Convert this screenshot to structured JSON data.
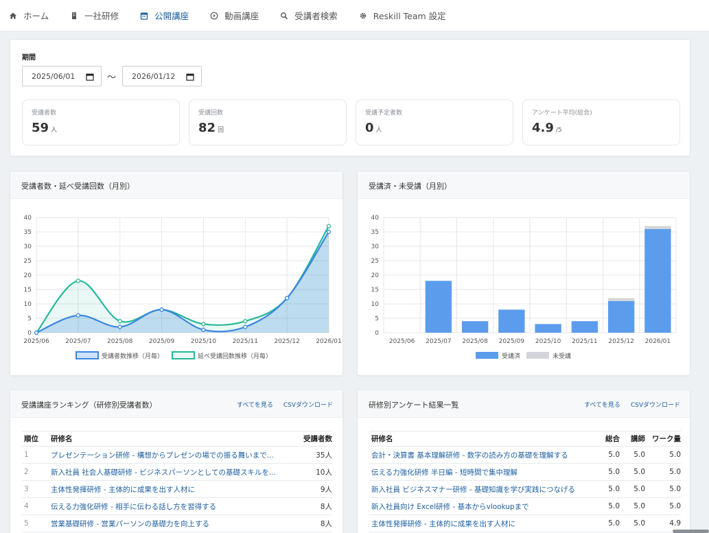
{
  "nav": {
    "items": [
      {
        "label": "ホーム"
      },
      {
        "label": "一社研修"
      },
      {
        "label": "公開講座"
      },
      {
        "label": "動画講座"
      },
      {
        "label": "受講者検索"
      },
      {
        "label": "Reskill Team 設定"
      }
    ],
    "active_index": 2
  },
  "period": {
    "label": "期間",
    "start": "2025/06/01",
    "end": "2026/01/12",
    "separator": "〜"
  },
  "stats": [
    {
      "label": "受講者数",
      "value": "59",
      "unit": "人"
    },
    {
      "label": "受講回数",
      "value": "82",
      "unit": "回"
    },
    {
      "label": "受講予定者数",
      "value": "0",
      "unit": "人"
    },
    {
      "label": "アンケート平均(総合)",
      "value": "4.9",
      "unit": "/5"
    }
  ],
  "line_card": {
    "title": "受講者数・延べ受講回数（月別）"
  },
  "bar_card": {
    "title": "受講済・未受講（月別）"
  },
  "colors": {
    "blue": "#3a86e0",
    "teal": "#26b89a",
    "bar_done": "#5b9cec",
    "bar_pending": "#d3d5d8",
    "link": "#1d5fa0"
  },
  "chart_data": [
    {
      "type": "line",
      "categories": [
        "2025/06",
        "2025/07",
        "2025/08",
        "2025/09",
        "2025/10",
        "2025/11",
        "2025/12",
        "2026/01"
      ],
      "series": [
        {
          "name": "受講者数推移（月毎）",
          "values": [
            0,
            6,
            2,
            8,
            1,
            2,
            12,
            35
          ]
        },
        {
          "name": "延べ受講回数推移（月毎）",
          "values": [
            0,
            18,
            4,
            8,
            3,
            4,
            12,
            37
          ]
        }
      ],
      "y_ticks": [
        "0",
        "5",
        "10",
        "15",
        "20",
        "25",
        "30",
        "35",
        "40"
      ],
      "ylim": [
        0,
        40
      ],
      "grid": true,
      "legend": "bottom"
    },
    {
      "type": "bar",
      "stacked": true,
      "categories": [
        "2025/06",
        "2025/07",
        "2025/08",
        "2025/09",
        "2025/10",
        "2025/11",
        "2025/12",
        "2026/01"
      ],
      "series": [
        {
          "name": "受講済",
          "values": [
            0,
            18,
            4,
            8,
            3,
            4,
            11,
            36
          ]
        },
        {
          "name": "未受講",
          "values": [
            0,
            0,
            0,
            0,
            0,
            0,
            1,
            1
          ]
        }
      ],
      "y_ticks": [
        "0",
        "5",
        "10",
        "15",
        "20",
        "25",
        "30",
        "35",
        "40"
      ],
      "ylim": [
        0,
        40
      ],
      "grid": true,
      "legend": "bottom"
    }
  ],
  "ranking": {
    "title": "受講講座ランキング（研修別受講者数）",
    "links": {
      "all": "すべてを見る",
      "csv": "CSVダウンロード"
    },
    "headers": {
      "rank": "順位",
      "name": "研修名",
      "count": "受講者数"
    },
    "rows": [
      {
        "rank": "1",
        "name": "プレゼンテーション研修 - 構想からプレゼンの場での振る舞いまで...",
        "count": "35人"
      },
      {
        "rank": "2",
        "name": "新入社員 社会人基礎研修 - ビジネスパーソンとしての基礎スキルを...",
        "count": "10人"
      },
      {
        "rank": "3",
        "name": "主体性発揮研修 - 主体的に成果を出す人材に",
        "count": "9人"
      },
      {
        "rank": "4",
        "name": "伝える力強化研修 - 相手に伝わる話し方を習得する",
        "count": "8人"
      },
      {
        "rank": "5",
        "name": "営業基礎研修 - 営業パーソンの基礎力を向上する",
        "count": "8人"
      }
    ]
  },
  "survey": {
    "title": "研修別アンケート結果一覧",
    "links": {
      "all": "すべてを見る",
      "csv": "CSVダウンロード"
    },
    "headers": {
      "name": "研修名",
      "total": "総合",
      "lecturer": "講師",
      "workload": "ワーク量"
    },
    "rows": [
      {
        "name": "会計・決算書 基本理解研修 - 数字の読み方の基礎を理解する",
        "total": "5.0",
        "lecturer": "5.0",
        "workload": "5.0"
      },
      {
        "name": "伝える力強化研修 半日編 - 短時間で集中理解",
        "total": "5.0",
        "lecturer": "5.0",
        "workload": "5.0"
      },
      {
        "name": "新入社員 ビジネスマナー研修 - 基礎知識を学び実践につなげる",
        "total": "5.0",
        "lecturer": "5.0",
        "workload": "5.0"
      },
      {
        "name": "新入社員向け Excel研修 - 基本からvlookupまで",
        "total": "5.0",
        "lecturer": "5.0",
        "workload": "5.0"
      },
      {
        "name": "主体性発揮研修 - 主体的に成果を出す人材に",
        "total": "5.0",
        "lecturer": "5.0",
        "workload": "4.9"
      }
    ]
  }
}
